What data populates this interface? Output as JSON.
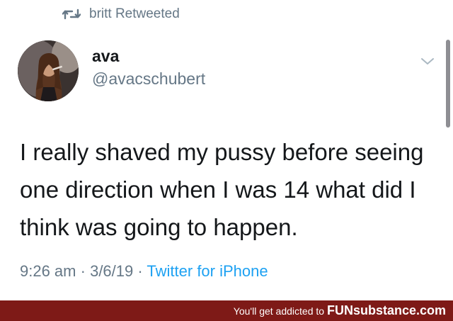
{
  "retweet": {
    "icon": "retweet-icon",
    "label": "britt Retweeted"
  },
  "tweet": {
    "author_name": "ava",
    "author_handle": "@avacschubert",
    "text": "I really shaved my pussy before seeing one direction when I was 14 what did I think was going to happen.",
    "time": "9:26 am",
    "date": "3/6/19",
    "source": "Twitter for iPhone",
    "separator": "·",
    "menu_icon": "chevron-down-icon"
  },
  "watermark": {
    "prefix": "You'll get addicted to",
    "brand": "FUNsubstance.com"
  },
  "colors": {
    "text": "#14171a",
    "muted": "#657786",
    "link": "#1da1f2",
    "banner": "#7e1a17"
  }
}
